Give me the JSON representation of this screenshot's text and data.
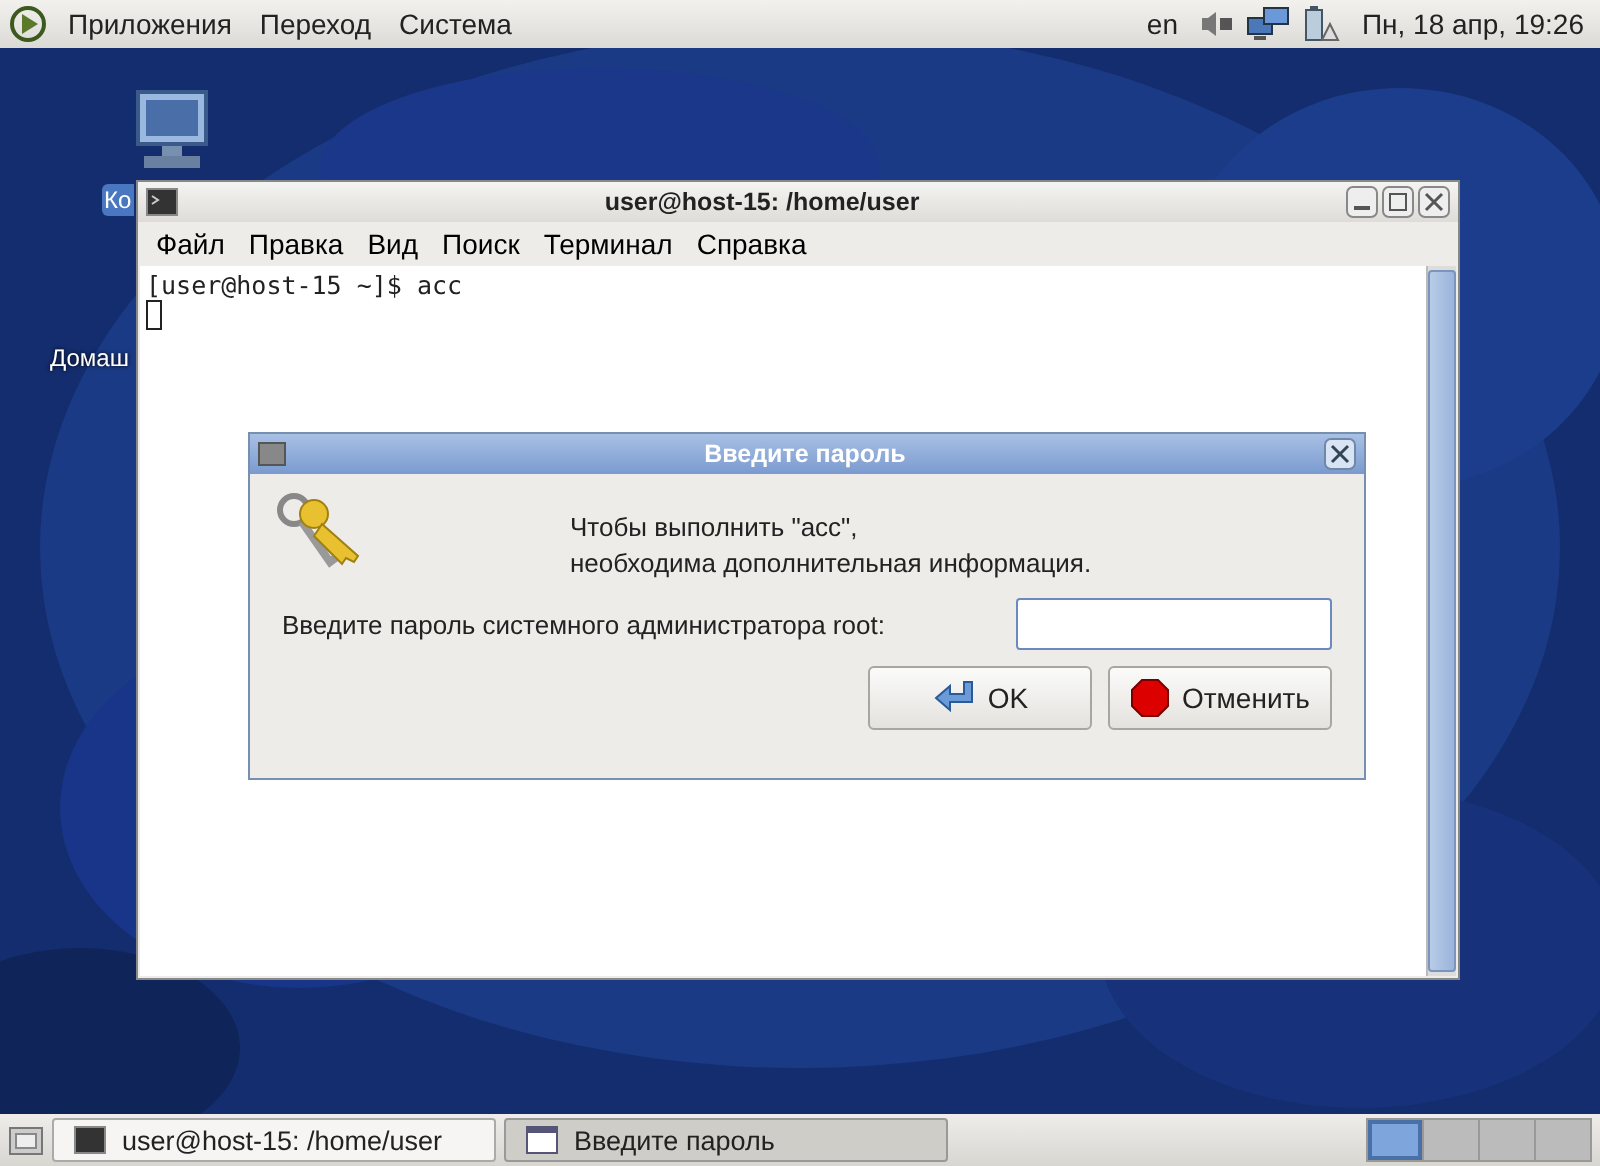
{
  "top_panel": {
    "menus": [
      "Приложения",
      "Переход",
      "Система"
    ],
    "keyboard_layout": "en",
    "clock": "Пн, 18 апр, 19:26"
  },
  "desktop_icons": [
    {
      "label": "Ко",
      "selected": true
    },
    {
      "label": "Домаш",
      "selected": false
    }
  ],
  "terminal": {
    "title": "user@host-15: /home/user",
    "menus": [
      "Файл",
      "Правка",
      "Вид",
      "Поиск",
      "Терминал",
      "Справка"
    ],
    "lines": [
      "[user@host-15 ~]$ acc"
    ]
  },
  "dialog": {
    "title": "Введите пароль",
    "message_lines": [
      "Чтобы выполнить \"acc\",",
      "необходима дополнительная информация."
    ],
    "prompt": "Введите пароль системного администратора root:",
    "buttons": [
      {
        "label": "OK",
        "kind": "ok"
      },
      {
        "label": "Отменить",
        "kind": "cancel"
      }
    ]
  },
  "taskbar": {
    "tasks": [
      {
        "label": "user@host-15: /home/user",
        "kind": "terminal",
        "selected": false
      },
      {
        "label": "Введите пароль",
        "kind": "window",
        "selected": true
      }
    ],
    "workspaces": [
      {
        "selected": true
      },
      {
        "selected": false
      },
      {
        "selected": false
      },
      {
        "selected": false
      }
    ]
  }
}
